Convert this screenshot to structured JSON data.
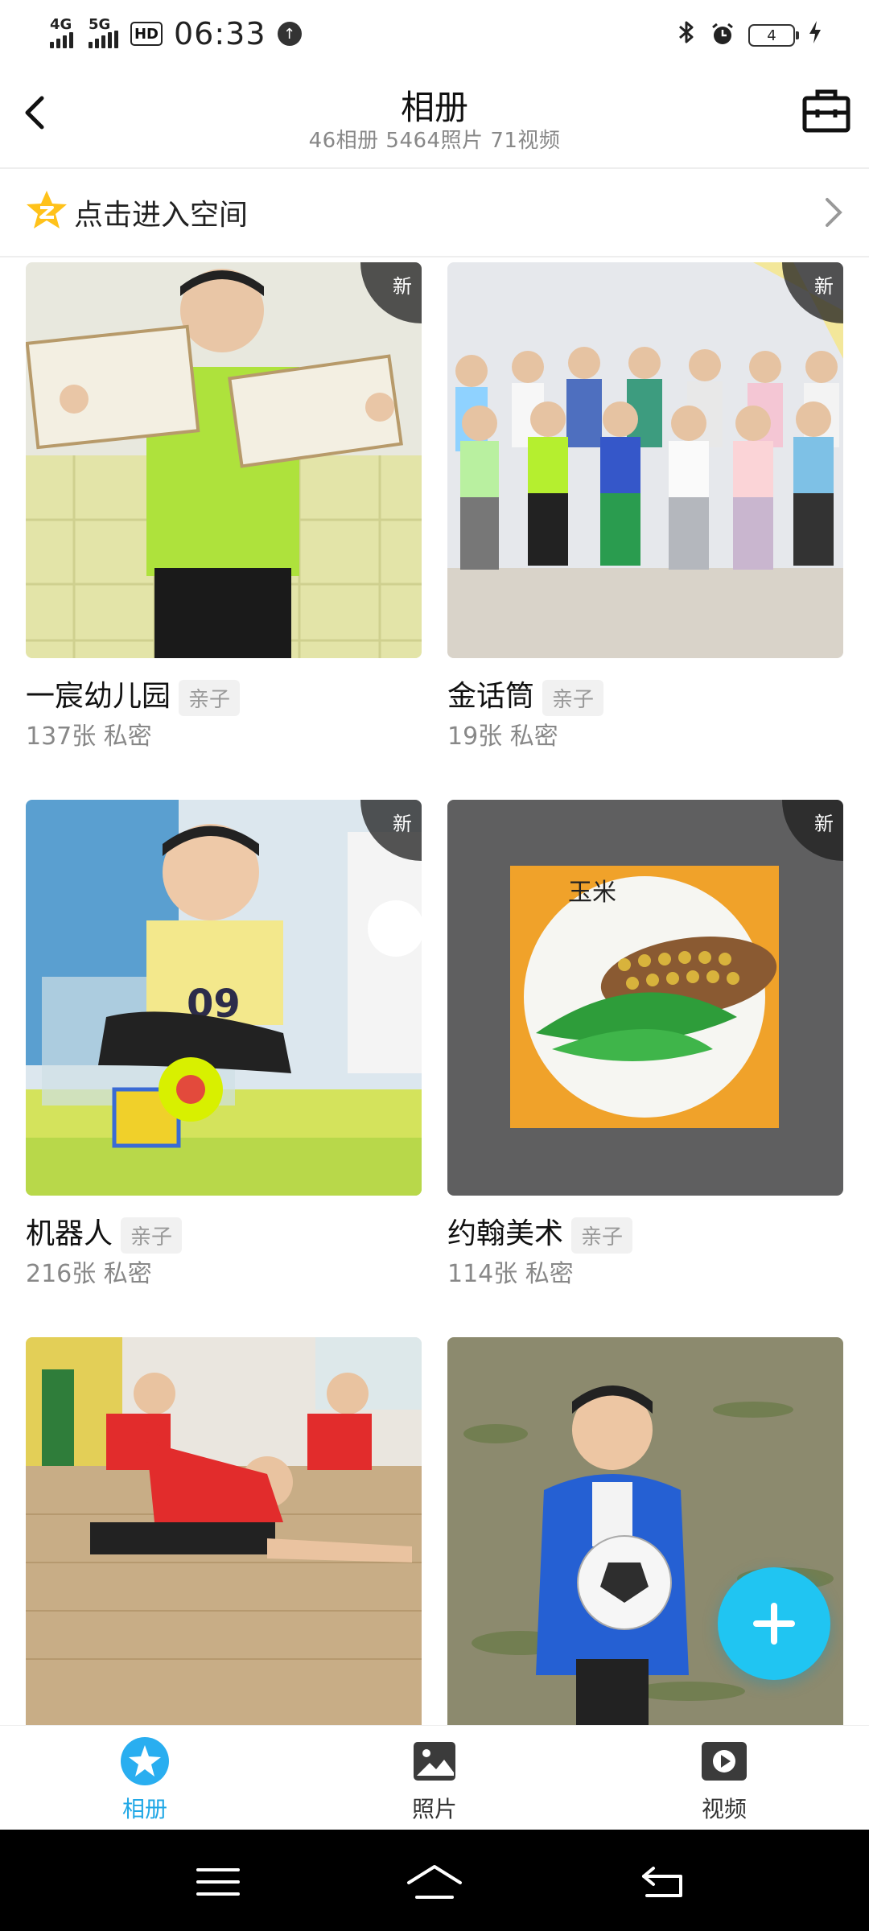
{
  "status_bar": {
    "signal1": "4G",
    "signal2": "5G",
    "hd": "HD",
    "time": "06:33",
    "battery": "4"
  },
  "header": {
    "title": "相册",
    "subtitle": "46相册  5464照片  71视频"
  },
  "space_entry": {
    "label": "点击进入空间"
  },
  "albums": [
    {
      "name": "一宸幼儿园",
      "tag": "亲子",
      "meta": "137张  私密",
      "new_label": "新",
      "photo": "boy-holding-certificates"
    },
    {
      "name": "金话筒",
      "tag": "亲子",
      "meta": "19张  私密",
      "new_label": "新",
      "photo": "children-group-photo"
    },
    {
      "name": "机器人",
      "tag": "亲子",
      "meta": "216张  私密",
      "new_label": "新",
      "photo": "boy-with-robot-toy"
    },
    {
      "name": "约翰美术",
      "tag": "亲子",
      "meta": "114张  私密",
      "new_label": "新",
      "photo": "corn-painting"
    },
    {
      "photo": "kids-stretching"
    },
    {
      "photo": "boy-with-soccer-ball"
    }
  ],
  "bottom_nav": {
    "items": [
      {
        "label": "相册",
        "icon": "album-icon",
        "active": true
      },
      {
        "label": "照片",
        "icon": "photo-icon",
        "active": false
      },
      {
        "label": "视频",
        "icon": "video-icon",
        "active": false
      }
    ]
  },
  "colors": {
    "accent": "#21a8e6",
    "fab": "#20c5f2"
  }
}
